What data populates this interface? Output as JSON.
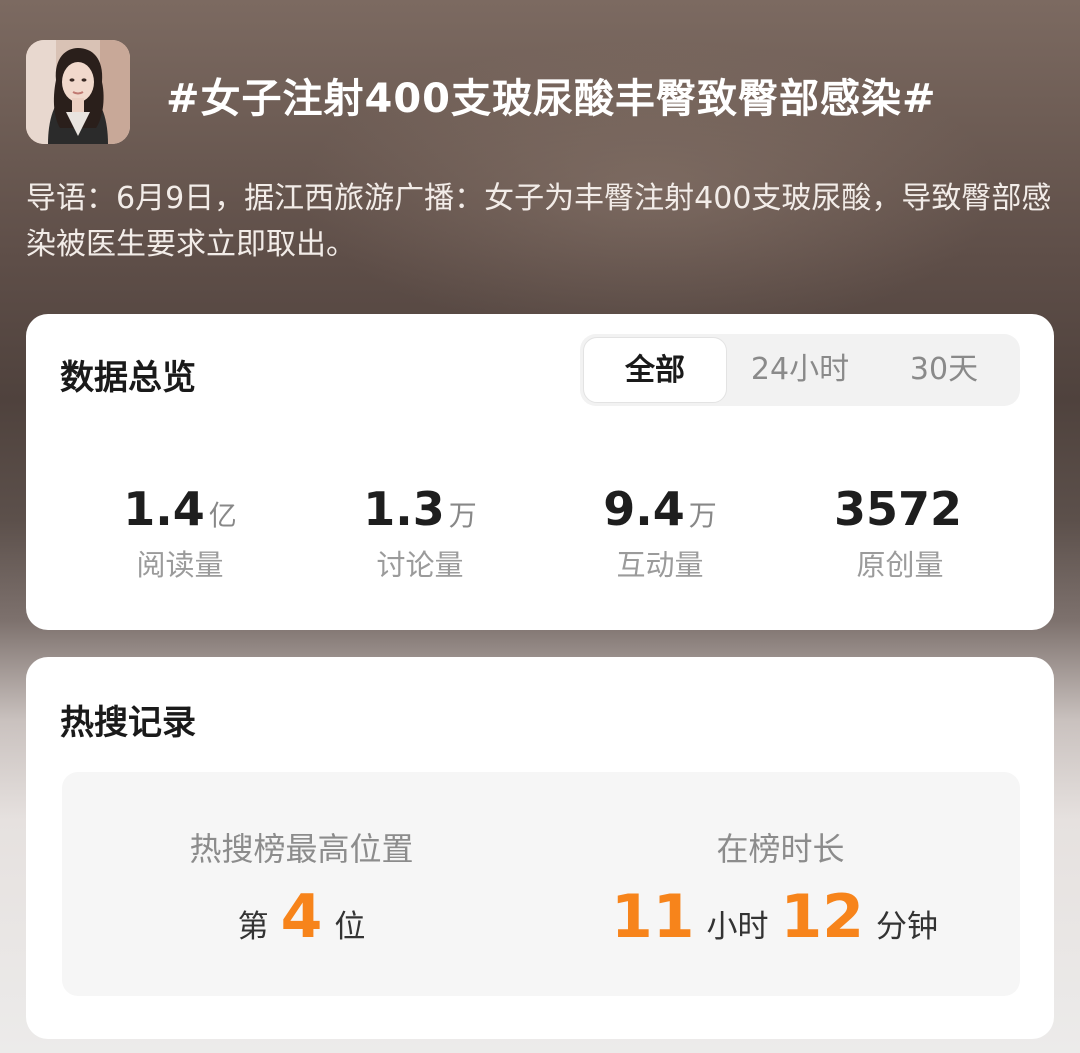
{
  "header": {
    "title": "#女子注射400支玻尿酸丰臀致臀部感染#",
    "avatar_icon": "avatar-woman-photo"
  },
  "intro": {
    "text": "导语：6月9日，据江西旅游广播：女子为丰臀注射400支玻尿酸，导致臀部感染被医生要求立即取出。"
  },
  "overview": {
    "title": "数据总览",
    "tabs": [
      {
        "label": "全部",
        "active": true
      },
      {
        "label": "24小时",
        "active": false
      },
      {
        "label": "30天",
        "active": false
      }
    ],
    "stats": [
      {
        "value": "1.4",
        "unit": "亿",
        "label": "阅读量"
      },
      {
        "value": "1.3",
        "unit": "万",
        "label": "讨论量"
      },
      {
        "value": "9.4",
        "unit": "万",
        "label": "互动量"
      },
      {
        "value": "3572",
        "unit": "",
        "label": "原创量"
      }
    ]
  },
  "hot": {
    "title": "热搜记录",
    "rank": {
      "label": "热搜榜最高位置",
      "prefix": "第",
      "number": "4",
      "suffix": "位"
    },
    "duration": {
      "label": "在榜时长",
      "hours": "11",
      "hours_unit": "小时",
      "minutes": "12",
      "minutes_unit": "分钟"
    }
  },
  "colors": {
    "accent": "#f7841b",
    "card_bg": "#ffffff",
    "segment_bg": "#f2f2f2"
  }
}
